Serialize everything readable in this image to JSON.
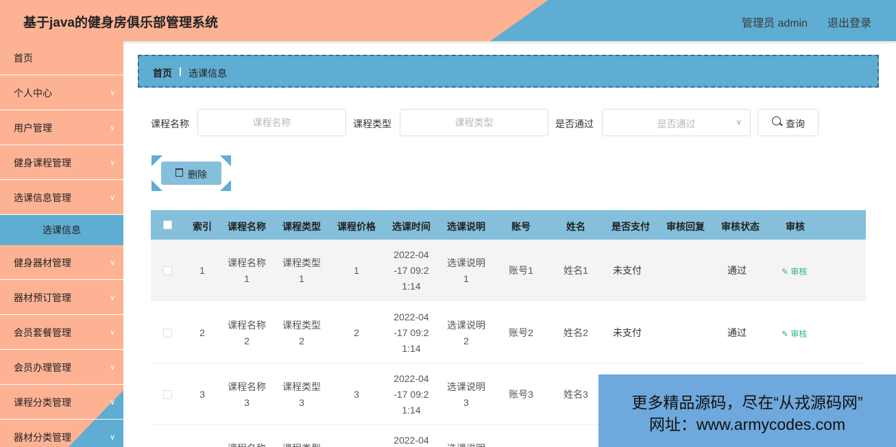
{
  "header": {
    "title": "基于java的健身房俱乐部管理系统",
    "user": "管理员 admin",
    "logout": "退出登录"
  },
  "colors": {
    "accent_blue": "#5fadd2",
    "accent_salmon": "#fdb294",
    "table_head": "#84bfdb"
  },
  "sidebar": {
    "items": [
      {
        "label": "首页",
        "icon": "none"
      },
      {
        "label": "个人中心",
        "icon": "chevron-down-icon"
      },
      {
        "label": "用户管理",
        "icon": "chevron-down-icon"
      },
      {
        "label": "健身课程管理",
        "icon": "chevron-down-icon"
      },
      {
        "label": "选课信息管理",
        "icon": "chevron-down-icon"
      },
      {
        "label": "健身器材管理",
        "icon": "chevron-down-icon"
      },
      {
        "label": "器材预订管理",
        "icon": "chevron-down-icon"
      },
      {
        "label": "会员套餐管理",
        "icon": "chevron-down-icon"
      },
      {
        "label": "会员办理管理",
        "icon": "chevron-down-icon"
      },
      {
        "label": "课程分类管理",
        "icon": "chevron-down-icon"
      },
      {
        "label": "器材分类管理",
        "icon": "chevron-down-icon"
      }
    ],
    "active_sub": "选课信息"
  },
  "breadcrumb": {
    "home": "首页",
    "sep": "|",
    "current": "选课信息"
  },
  "search": {
    "course_name_label": "课程名称",
    "course_name_placeholder": "课程名称",
    "course_type_label": "课程类型",
    "course_type_placeholder": "课程类型",
    "passed_label": "是否通过",
    "passed_placeholder": "是否通过",
    "query_button": "查询"
  },
  "actions": {
    "delete_button": "删除"
  },
  "table": {
    "headers": [
      "索引",
      "课程名称",
      "课程类型",
      "课程价格",
      "选课时间",
      "选课说明",
      "账号",
      "姓名",
      "是否支付",
      "审核回复",
      "审核状态",
      "审核"
    ],
    "rows": [
      {
        "index": "1",
        "name": [
          "课程名称",
          "1"
        ],
        "type": [
          "课程类型",
          "1"
        ],
        "price": "1",
        "time": [
          "2022-04",
          "-17 09:2",
          "1:14"
        ],
        "desc": [
          "选课说明",
          "1"
        ],
        "account": "账号1",
        "username": "姓名1",
        "paid": "未支付",
        "reply": "",
        "status": "通过",
        "audit": "审核"
      },
      {
        "index": "2",
        "name": [
          "课程名称",
          "2"
        ],
        "type": [
          "课程类型",
          "2"
        ],
        "price": "2",
        "time": [
          "2022-04",
          "-17 09:2",
          "1:14"
        ],
        "desc": [
          "选课说明",
          "2"
        ],
        "account": "账号2",
        "username": "姓名2",
        "paid": "未支付",
        "reply": "",
        "status": "通过",
        "audit": "审核"
      },
      {
        "index": "3",
        "name": [
          "课程名称",
          "3"
        ],
        "type": [
          "课程类型",
          "3"
        ],
        "price": "3",
        "time": [
          "2022-04",
          "-17 09:2",
          "1:14"
        ],
        "desc": [
          "选课说明",
          "3"
        ],
        "account": "账号3",
        "username": "姓名3"
      },
      {
        "name": [
          "课程名称"
        ],
        "type": [
          "课程类型"
        ],
        "time": [
          "2022-04"
        ],
        "desc": [
          "选课说明"
        ]
      }
    ]
  },
  "watermark": {
    "line1": "更多精品源码，尽在“从戎源码网”",
    "line2": "网址：www.armycodes.com"
  }
}
